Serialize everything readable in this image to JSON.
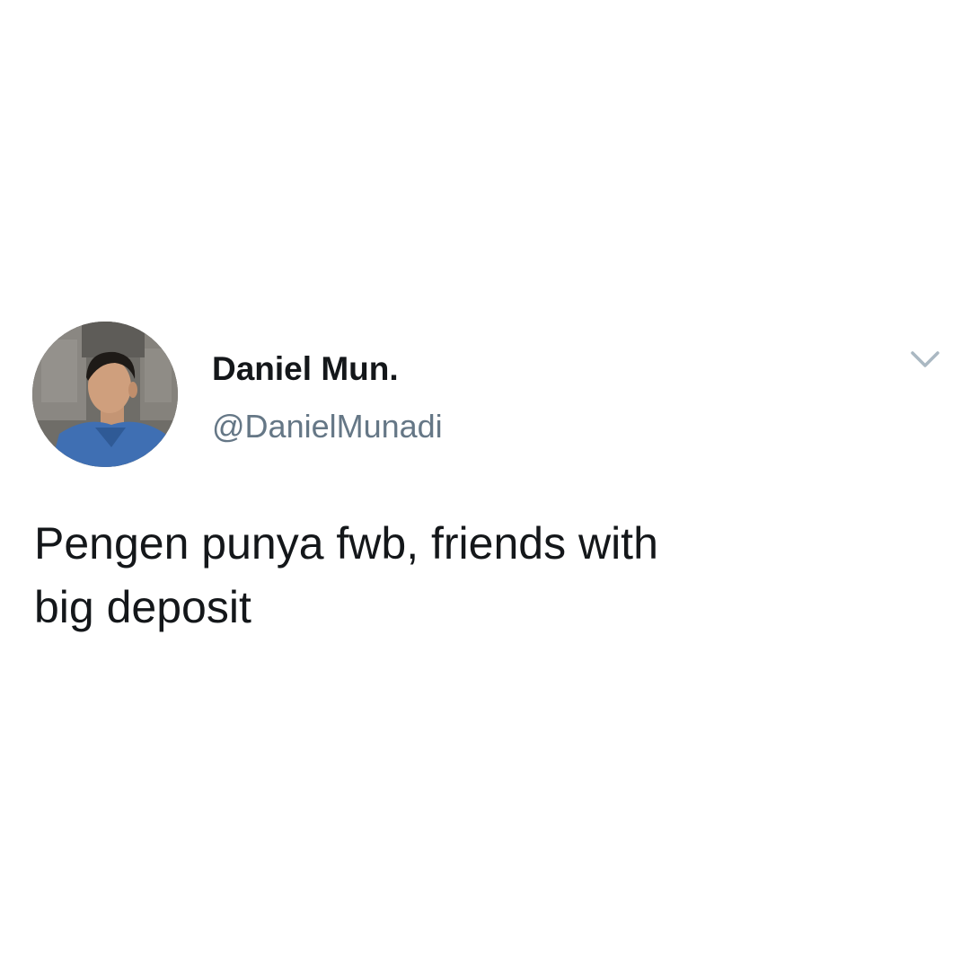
{
  "tweet": {
    "author": {
      "display_name": "Daniel Mun.",
      "handle": "@DanielMunadi",
      "avatar": "profile-photo"
    },
    "text": "Pengen punya fwb, friends with\nbig deposit",
    "menu_icon": "chevron-down-icon"
  },
  "colors": {
    "background": "#ffffff",
    "name_text": "#14171a",
    "handle_text": "#657786",
    "chevron": "#aab8c2"
  }
}
